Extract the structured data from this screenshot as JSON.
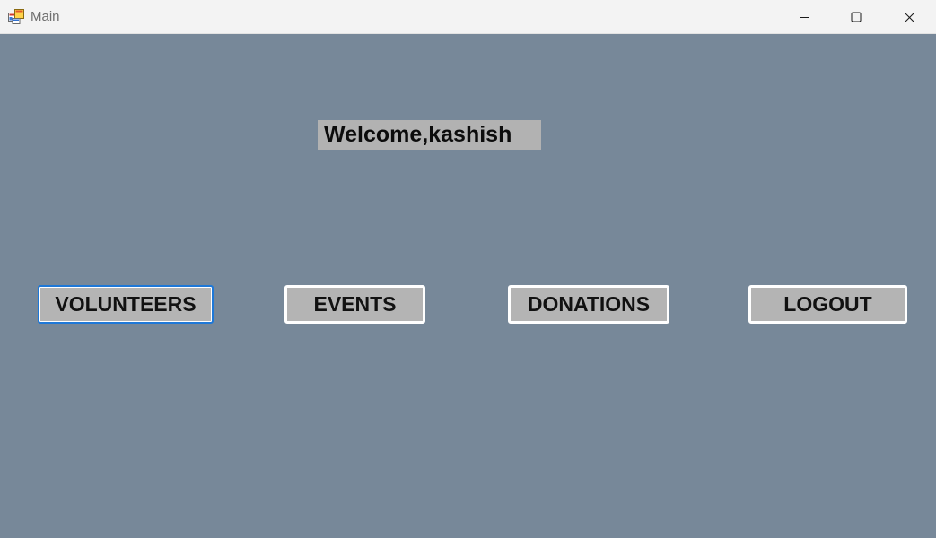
{
  "window": {
    "title": "Main",
    "app_icon": "winforms-app-icon",
    "controls": {
      "minimize_icon": "minimize-icon",
      "maximize_icon": "maximize-icon",
      "close_icon": "close-icon"
    }
  },
  "main": {
    "welcome_text": "Welcome,kashish",
    "buttons": [
      {
        "label": "VOLUNTEERS",
        "focused": true
      },
      {
        "label": "EVENTS",
        "focused": false
      },
      {
        "label": "DONATIONS",
        "focused": false
      },
      {
        "label": "LOGOUT",
        "focused": false
      }
    ]
  },
  "colors": {
    "client_background": "#778899",
    "button_background": "#b4b4b4",
    "label_background": "#b2b2b2",
    "focus_border": "#1e78d8",
    "titlebar_background": "#f3f3f3"
  }
}
